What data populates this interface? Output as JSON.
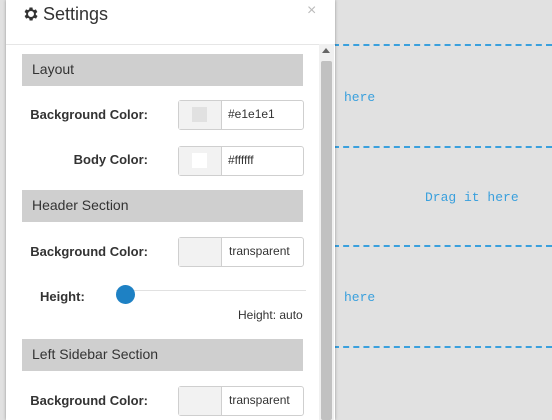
{
  "panel": {
    "title": "Settings",
    "close": "×"
  },
  "canvas": {
    "drop_texts": [
      "here",
      "Drag it here",
      "here"
    ]
  },
  "sections": {
    "layout": {
      "title": "Layout",
      "bg_label": "Background Color:",
      "bg_value": "#e1e1e1",
      "body_label": "Body Color:",
      "body_value": "#ffffff"
    },
    "header": {
      "title": "Header Section",
      "bg_label": "Background Color:",
      "bg_value": "transparent",
      "height_label": "Height:",
      "height_note": "Height: auto"
    },
    "left_sidebar": {
      "title": "Left Sidebar Section",
      "bg_label": "Background Color:",
      "bg_value": "transparent"
    }
  },
  "colors": {
    "accent": "#3aa0dd",
    "slider": "#1e81c4",
    "section_bg": "#cfcfcf",
    "swatch_layout_bg": "#e1e1e1",
    "swatch_body": "#ffffff"
  }
}
